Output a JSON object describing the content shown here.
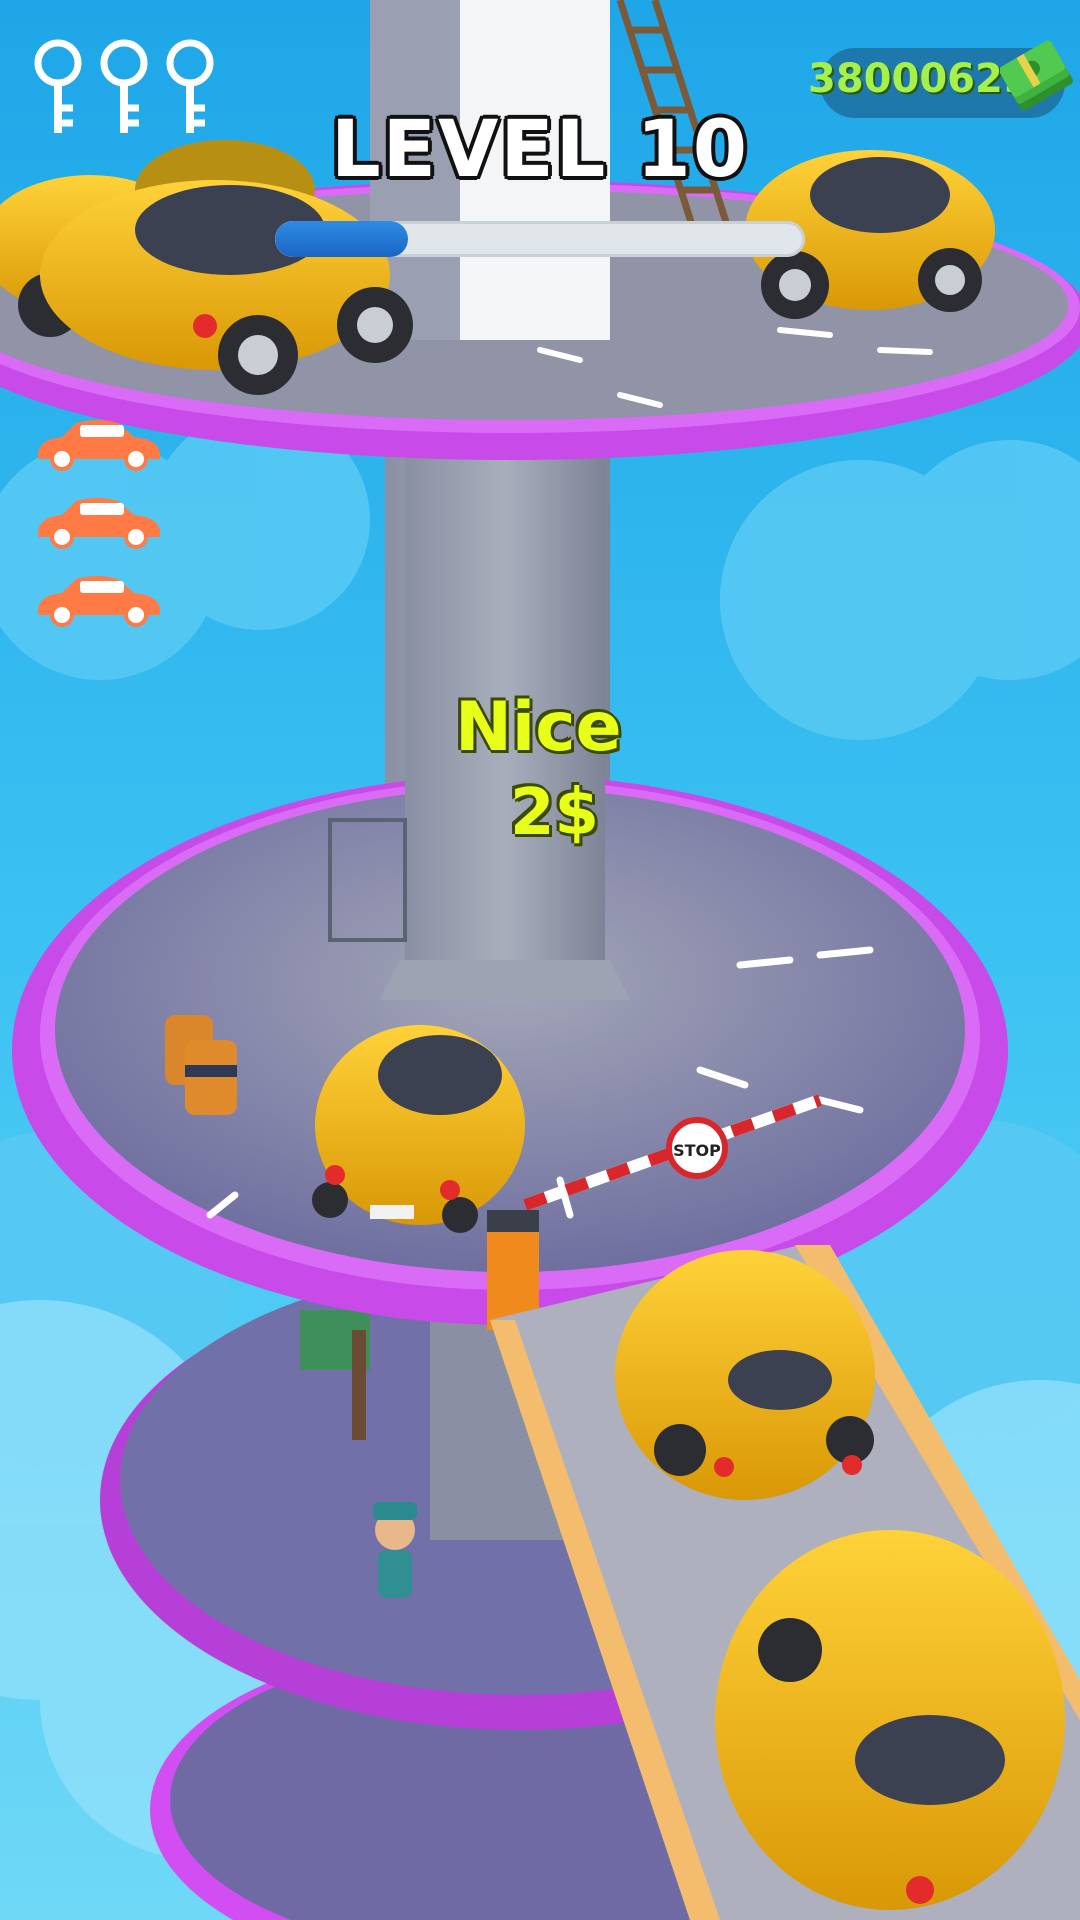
{
  "hud": {
    "level_label": "LEVEL 10",
    "money": "38000629",
    "level_progress": 0.25,
    "keys_count": 3,
    "lives_count": 3
  },
  "popup": {
    "title": "Nice",
    "reward": "2$"
  },
  "scene": {
    "stop_sign_text": "STOP"
  },
  "colors": {
    "sky": "#35b8ef",
    "ring": "#d24ef2",
    "platform": "#8b8fae",
    "car": "#f5b914",
    "life_car": "#ff7a45",
    "popup_text": "#e8ff1a",
    "money_text": "#a6f04a",
    "progress_fill": "#2277d4"
  },
  "icons": [
    "key-icon",
    "cash-stack-icon",
    "life-car-icon",
    "stop-sign-icon"
  ]
}
